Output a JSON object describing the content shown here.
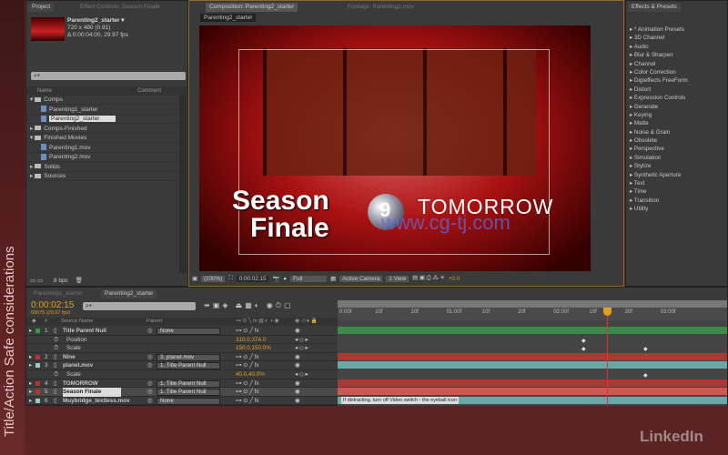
{
  "overlay": {
    "side_title": "Title/Action Safe considerations",
    "brand": "LinkedIn"
  },
  "project": {
    "tab": "Project",
    "tab2": "Effect Controls: Season Finale",
    "comp_name": "Parenting2_starter ▾",
    "comp_size": "720 x 480 (0.91)",
    "comp_duration": "Δ 0:00:04:00, 29.97 fps",
    "search_placeholder": "",
    "col_name": "Name",
    "col_comment": "Comment",
    "items": [
      {
        "label": "Comps",
        "type": "folder",
        "open": true
      },
      {
        "label": "Parenting1_starter",
        "type": "comp",
        "indent": 1
      },
      {
        "label": "Parenting2_starter",
        "type": "comp",
        "indent": 1,
        "selected": true
      },
      {
        "label": "Comps-Finished",
        "type": "folder"
      },
      {
        "label": "Finished Movies",
        "type": "folder",
        "open": true
      },
      {
        "label": "Parenting1.mov",
        "type": "file",
        "indent": 1
      },
      {
        "label": "Parenting2.mov",
        "type": "file",
        "indent": 1
      },
      {
        "label": "Solids",
        "type": "folder"
      },
      {
        "label": "Sources",
        "type": "folder"
      }
    ],
    "bpc": "8 bpc"
  },
  "composition": {
    "tab": "Composition: Parenting2_starter",
    "tab2": "Footage: Parenting2.mov",
    "breadcrumb": "Parenting2_starter",
    "viewer": {
      "title_line1": "Season",
      "title_line2": "Finale",
      "planet_number": "9",
      "tomorrow": "TOMORROW",
      "watermark": "www.cg-tj.com"
    },
    "toolbar": {
      "zoom": "(100%)",
      "timecode": "0:00:02:15",
      "resolution": "Full",
      "camera": "Active Camera",
      "views": "1 View",
      "exposure": "+0.0"
    }
  },
  "effects": {
    "tab": "Effects & Presets",
    "items": [
      "* Animation Presets",
      "3D Channel",
      "Audio",
      "Blur & Sharpen",
      "Channel",
      "Color Correction",
      "Digieffects FreeForm",
      "Distort",
      "Expression Controls",
      "Generate",
      "Keying",
      "Matte",
      "Noise & Grain",
      "Obsolete",
      "Perspective",
      "Simulation",
      "Stylize",
      "Synthetic Aperture",
      "Text",
      "Time",
      "Transition",
      "Utility"
    ]
  },
  "timeline": {
    "tabs": [
      "Parenting1_starter",
      "Parenting2_starter"
    ],
    "timecode": "0:00:02:15",
    "frame_info": "00075 (29.97 fps)",
    "col_num": "#",
    "col_source": "Source Name",
    "col_parent": "Parent",
    "ruler": [
      "0:00f",
      "10f",
      "20f",
      "01:00f",
      "10f",
      "20f",
      "02:00f",
      "10f",
      "20f",
      "03:00f"
    ],
    "playhead_seconds": 2.5,
    "layers": [
      {
        "num": "1",
        "name": "Title Parent Null",
        "label_color": "#3a9a4a",
        "parent": "None",
        "bar_color": "#3e8a4a"
      },
      {
        "prop": "Position",
        "value": "310.0,374.0"
      },
      {
        "prop": "Scale",
        "value": "150.0,150.0%"
      },
      {
        "num": "2",
        "name": "Nine",
        "label_color": "#c03030",
        "parent": "3. planet.mov",
        "bar_color": "#a83a34"
      },
      {
        "num": "3",
        "name": "planet.mov",
        "label_color": "#9cc8c8",
        "parent": "1. Title Parent Null",
        "bar_color": "#6aa8a8"
      },
      {
        "prop": "Scale",
        "value": "40.0,40.0%"
      },
      {
        "num": "4",
        "name": "TOMORROW",
        "label_color": "#c03030",
        "parent": "1. Title Parent Null",
        "bar_color": "#a83a34"
      },
      {
        "num": "5",
        "name": "Season Finale",
        "label_color": "#c03030",
        "parent": "1. Title Parent Null",
        "bar_color": "#cc5a50",
        "selected": true
      },
      {
        "num": "6",
        "name": "Muybridge_textless.mov",
        "label_color": "#9cc8c8",
        "parent": "None",
        "bar_color": "#6aa8a8"
      }
    ],
    "marker_comment": "If distracting, turn off Video switch - the eyeball icon"
  }
}
